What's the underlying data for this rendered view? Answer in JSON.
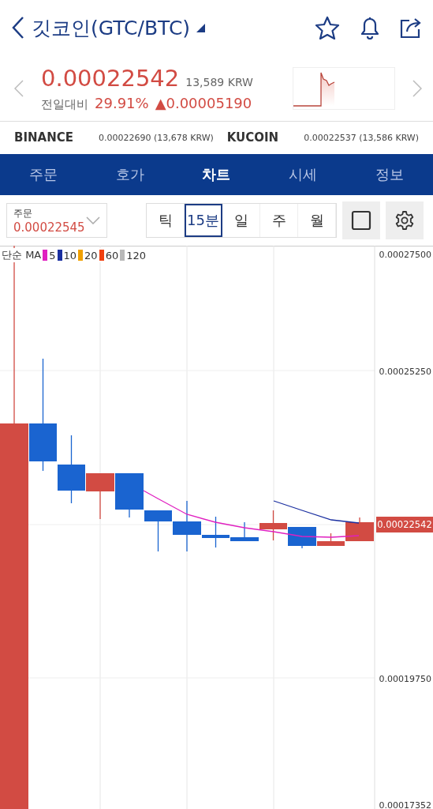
{
  "header": {
    "title": "깃코인(GTC/BTC)"
  },
  "quote": {
    "price": "0.00022542",
    "krw": "13,589 KRW",
    "change_label": "전일대비",
    "change_pct": "29.91%",
    "change_amount": "▲0.00005190"
  },
  "exchanges": [
    {
      "name": "BINANCE",
      "value": "0.00022690 (13,678 KRW)"
    },
    {
      "name": "KUCOIN",
      "value": "0.00022537 (13,586 KRW)"
    }
  ],
  "tabs": [
    {
      "label": "주문",
      "selected": false
    },
    {
      "label": "호가",
      "selected": false
    },
    {
      "label": "차트",
      "selected": true
    },
    {
      "label": "시세",
      "selected": false
    },
    {
      "label": "정보",
      "selected": false
    }
  ],
  "order_select": {
    "label": "주문",
    "value": "0.00022545"
  },
  "periods": [
    {
      "label": "틱",
      "selected": false
    },
    {
      "label": "15분",
      "selected": true
    },
    {
      "label": "일",
      "selected": false
    },
    {
      "label": "주",
      "selected": false
    },
    {
      "label": "월",
      "selected": false
    }
  ],
  "chart": {
    "legend_label": "단순 MA",
    "ma": [
      {
        "label": "5",
        "color": "#e020c0"
      },
      {
        "label": "10",
        "color": "#1a2fa0"
      },
      {
        "label": "20",
        "color": "#f0a000"
      },
      {
        "label": "60",
        "color": "#f04010"
      },
      {
        "label": "120",
        "color": "#b8b8b8"
      }
    ],
    "y_labels": [
      "0.00027500",
      "0.00025250",
      "0.00019750",
      "0.00017352"
    ],
    "current_price": "0.00022542"
  }
}
